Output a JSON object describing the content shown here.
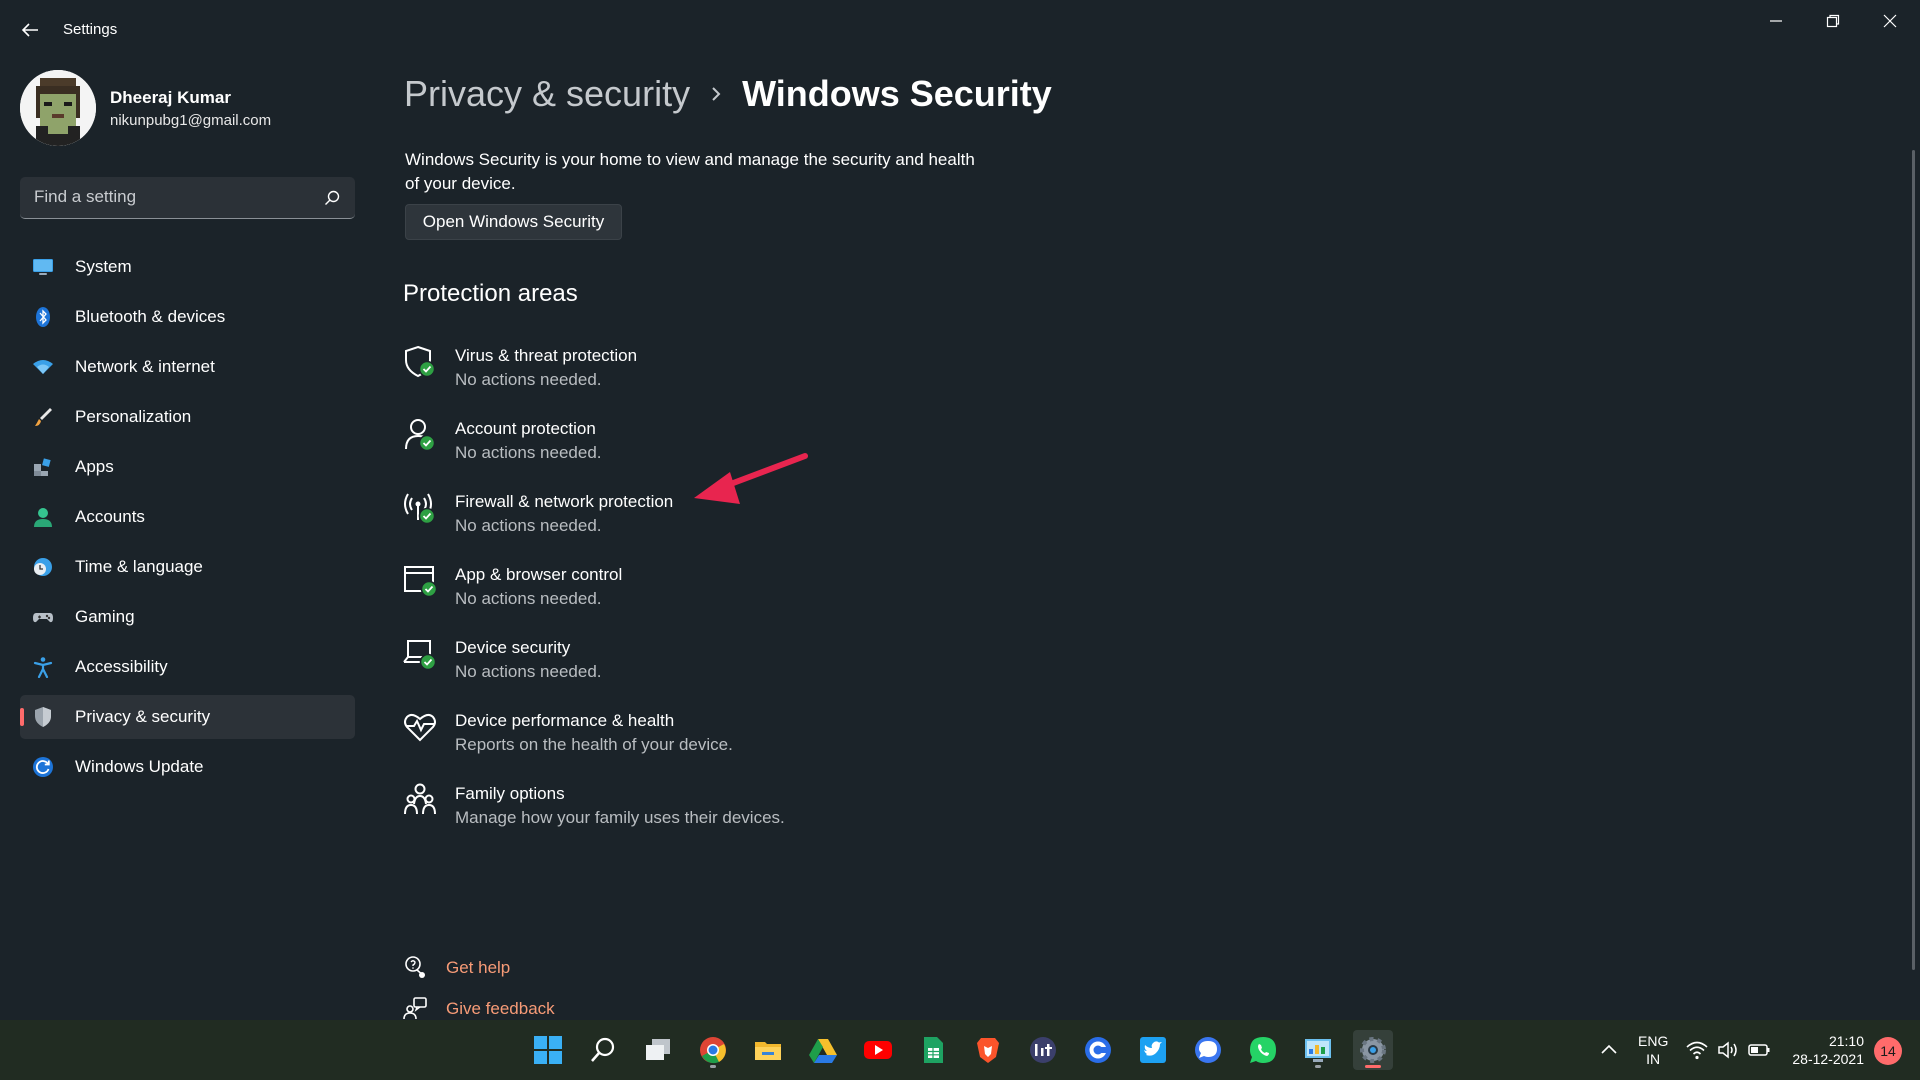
{
  "window": {
    "title": "Settings"
  },
  "profile": {
    "name": "Dheeraj Kumar",
    "email": "nikunpubg1@gmail.com"
  },
  "search": {
    "placeholder": "Find a setting"
  },
  "sidebar": {
    "items": [
      {
        "label": "System",
        "icon": "monitor-icon"
      },
      {
        "label": "Bluetooth & devices",
        "icon": "bluetooth-icon"
      },
      {
        "label": "Network & internet",
        "icon": "wifi-icon"
      },
      {
        "label": "Personalization",
        "icon": "brush-icon"
      },
      {
        "label": "Apps",
        "icon": "apps-icon"
      },
      {
        "label": "Accounts",
        "icon": "person-icon"
      },
      {
        "label": "Time & language",
        "icon": "globe-clock-icon"
      },
      {
        "label": "Gaming",
        "icon": "gamepad-icon"
      },
      {
        "label": "Accessibility",
        "icon": "accessibility-icon"
      },
      {
        "label": "Privacy & security",
        "icon": "shield-icon",
        "active": true
      },
      {
        "label": "Windows Update",
        "icon": "update-icon"
      }
    ]
  },
  "header": {
    "parent": "Privacy & security",
    "current": "Windows Security"
  },
  "main": {
    "description": "Windows Security is your home to view and manage the security and health of your device.",
    "open_button": "Open Windows Security",
    "section_title": "Protection areas",
    "areas": [
      {
        "title": "Virus & threat protection",
        "subtitle": "No actions needed.",
        "icon": "shield-check-icon"
      },
      {
        "title": "Account protection",
        "subtitle": "No actions needed.",
        "icon": "account-check-icon"
      },
      {
        "title": "Firewall & network protection",
        "subtitle": "No actions needed.",
        "icon": "firewall-antenna-icon"
      },
      {
        "title": "App & browser control",
        "subtitle": "No actions needed.",
        "icon": "browser-check-icon"
      },
      {
        "title": "Device security",
        "subtitle": "No actions needed.",
        "icon": "laptop-check-icon"
      },
      {
        "title": "Device performance & health",
        "subtitle": "Reports on the health of your device.",
        "icon": "heart-pulse-icon"
      },
      {
        "title": "Family options",
        "subtitle": "Manage how your family uses their devices.",
        "icon": "family-icon"
      }
    ],
    "links": {
      "help": "Get help",
      "feedback": "Give feedback"
    }
  },
  "taskbar": {
    "language": {
      "line1": "ENG",
      "line2": "IN"
    },
    "time": "21:10",
    "date": "28-12-2021",
    "notifications": "14",
    "apps": [
      "start",
      "search",
      "task-view",
      "chrome",
      "file-explorer",
      "google-drive",
      "youtube",
      "google-sheets",
      "brave",
      "bit",
      "ccleaner",
      "twitter",
      "signal",
      "whatsapp",
      "control-panel",
      "settings"
    ]
  },
  "colors": {
    "background": "#1b2329",
    "accent": "#ff6b6b",
    "link": "#f79b77",
    "success_badge": "#2ea043",
    "annotation_arrow": "#e8254f"
  }
}
